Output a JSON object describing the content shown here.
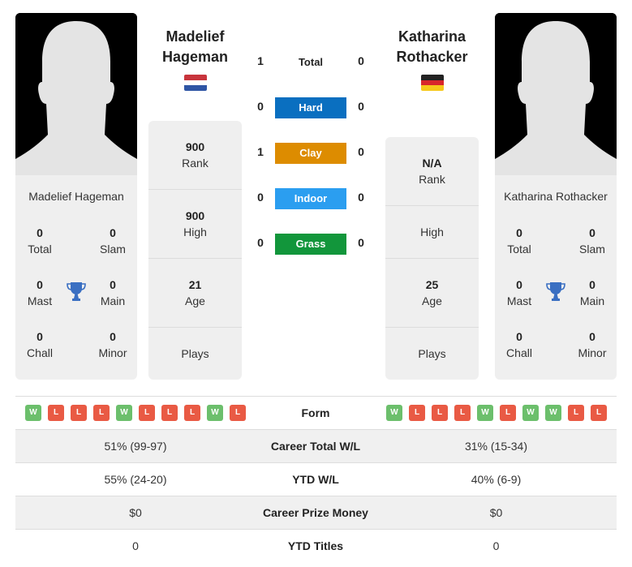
{
  "left_player": {
    "name_line1": "Madelief",
    "name_line2": "Hageman",
    "full_name": "Madelief Hageman",
    "country_flag": "netherlands-flag",
    "titles": {
      "total": {
        "value": "0",
        "label": "Total"
      },
      "slam": {
        "value": "0",
        "label": "Slam"
      },
      "mast": {
        "value": "0",
        "label": "Mast"
      },
      "main": {
        "value": "0",
        "label": "Main"
      },
      "chall": {
        "value": "0",
        "label": "Chall"
      },
      "minor": {
        "value": "0",
        "label": "Minor"
      }
    },
    "stats": {
      "rank": {
        "value": "900",
        "label": "Rank"
      },
      "high": {
        "value": "900",
        "label": "High"
      },
      "age": {
        "value": "21",
        "label": "Age"
      },
      "plays": {
        "value": "",
        "label": "Plays"
      }
    },
    "form": [
      "W",
      "L",
      "L",
      "L",
      "W",
      "L",
      "L",
      "L",
      "W",
      "L"
    ]
  },
  "right_player": {
    "name_line1": "Katharina",
    "name_line2": "Rothacker",
    "full_name": "Katharina Rothacker",
    "country_flag": "germany-flag",
    "titles": {
      "total": {
        "value": "0",
        "label": "Total"
      },
      "slam": {
        "value": "0",
        "label": "Slam"
      },
      "mast": {
        "value": "0",
        "label": "Mast"
      },
      "main": {
        "value": "0",
        "label": "Main"
      },
      "chall": {
        "value": "0",
        "label": "Chall"
      },
      "minor": {
        "value": "0",
        "label": "Minor"
      }
    },
    "stats": {
      "rank": {
        "value": "N/A",
        "label": "Rank"
      },
      "high": {
        "value": "",
        "label": "High"
      },
      "age": {
        "value": "25",
        "label": "Age"
      },
      "plays": {
        "value": "",
        "label": "Plays"
      }
    },
    "form": [
      "W",
      "L",
      "L",
      "L",
      "W",
      "L",
      "W",
      "W",
      "L",
      "L"
    ]
  },
  "h2h": [
    {
      "label": "Total",
      "left": "1",
      "right": "0",
      "color": ""
    },
    {
      "label": "Hard",
      "left": "0",
      "right": "0",
      "color": "#0a6fc0"
    },
    {
      "label": "Clay",
      "left": "1",
      "right": "0",
      "color": "#dd8c00"
    },
    {
      "label": "Indoor",
      "left": "0",
      "right": "0",
      "color": "#2b9ef0"
    },
    {
      "label": "Grass",
      "left": "0",
      "right": "0",
      "color": "#12963b"
    }
  ],
  "comparison": {
    "form_label": "Form",
    "rows": [
      {
        "label": "Career Total W/L",
        "left": "51% (99-97)",
        "right": "31% (15-34)"
      },
      {
        "label": "YTD W/L",
        "left": "55% (24-20)",
        "right": "40% (6-9)"
      },
      {
        "label": "Career Prize Money",
        "left": "$0",
        "right": "$0"
      },
      {
        "label": "YTD Titles",
        "left": "0",
        "right": "0"
      }
    ]
  }
}
